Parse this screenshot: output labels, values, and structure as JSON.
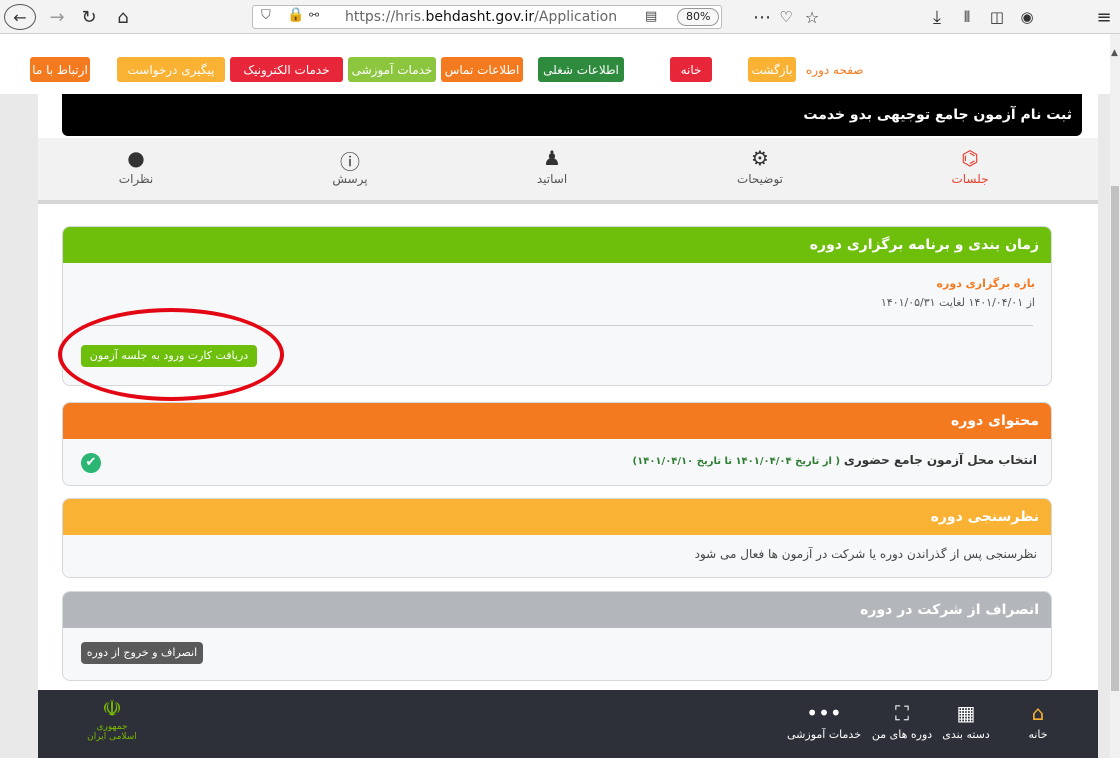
{
  "browser": {
    "url_prefix": "https://hris.",
    "url_domain": "behdasht.gov.ir",
    "url_suffix": "/Application",
    "zoom": "80%"
  },
  "nav": {
    "back_page_label": "صفحه دوره",
    "back_button": "بازگشت",
    "home": "خانه",
    "job_info": "اطلاعات شغلی",
    "contact_info": "اطلاعات تماس",
    "training_services": "خدمات آموزشی",
    "electronic_services": "خدمات الکترونیک",
    "request_tracking": "پیگیری درخواست",
    "contact_us": "ارتباط با ما"
  },
  "page": {
    "title": "ثبت نام آزمون جامع توجیهی بدو خدمت",
    "tabs": [
      {
        "label": "جلسات",
        "icon": "sessions-icon"
      },
      {
        "label": "توضیحات",
        "icon": "description-icon"
      },
      {
        "label": "اساتید",
        "icon": "teachers-icon"
      },
      {
        "label": "پرسش",
        "icon": "question-icon"
      },
      {
        "label": "نظرات",
        "icon": "comments-icon"
      }
    ]
  },
  "schedule": {
    "heading": "زمان بندی و برنامه برگزاری دوره",
    "period_label": "بازه برگزاری دوره",
    "period_value": "از ۱۴۰۱/۰۴/۰۱ لغایت ۱۴۰۱/۰۵/۳۱",
    "entry_card_button": "دریافت کارت ورود به جلسه آزمون"
  },
  "content_section": {
    "heading": "محتوای دوره",
    "item_title": "انتخاب محل آزمون جامع حضوری",
    "item_dates": "( از تاریخ ۱۴۰۱/۰۴/۰۴ تا تاریخ ۱۴۰۱/۰۴/۱۰)"
  },
  "survey": {
    "heading": "نظرسنجی دوره",
    "text": "نظرسنجی پس از گذراندن دوره یا شرکت در آزمون ها فعال می شود"
  },
  "withdraw": {
    "heading": "انصراف از شرکت در دوره",
    "button": "انصراف و خروج از دوره"
  },
  "bottom_nav": {
    "home": "خانه",
    "categories": "دسته بندی",
    "my_courses": "دوره های من",
    "training_services": "خدمات آموزشی",
    "emblem_text": "جمهوری اسلامی ایران"
  },
  "colors": {
    "green": "#6dbf0b",
    "orange": "#f47a20",
    "yellow": "#f9b233",
    "gray": "#b3b6ba",
    "red": "#e8402f"
  }
}
